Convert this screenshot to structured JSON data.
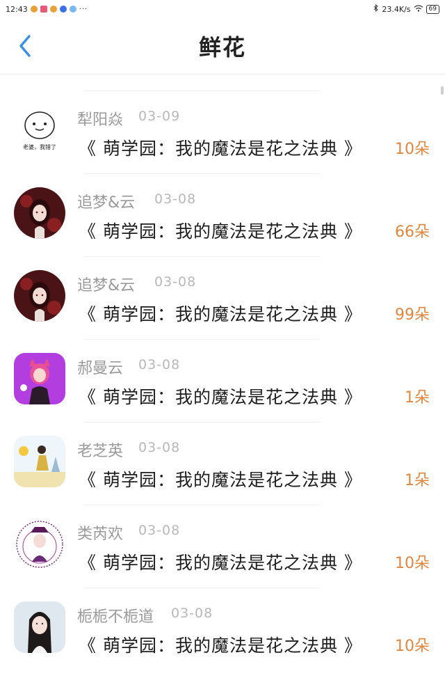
{
  "status_bar": {
    "time": "12:43",
    "network_speed": "23.4K/s",
    "battery": "69",
    "more": "···"
  },
  "header": {
    "title": "鲜花",
    "back_icon": "chevron-left-icon"
  },
  "colors": {
    "accent_blue": "#3a8ee6",
    "amount_orange": "#e0863e",
    "name_gray": "#9a9a9a",
    "date_gray": "#b8b8b8"
  },
  "records": [
    {
      "name": "犁阳焱",
      "date": "03-09",
      "book": "《 萌学园：我的魔法是花之法典 》",
      "amount": "10朵",
      "avatar_caption": "老婆，我错了"
    },
    {
      "name": "追梦&云",
      "date": "03-08",
      "book": "《 萌学园：我的魔法是花之法典 》",
      "amount": "66朵"
    },
    {
      "name": "追梦&云",
      "date": "03-08",
      "book": "《 萌学园：我的魔法是花之法典 》",
      "amount": "99朵"
    },
    {
      "name": "郝曼云",
      "date": "03-08",
      "book": "《 萌学园：我的魔法是花之法典 》",
      "amount": "1朵"
    },
    {
      "name": "老芝英",
      "date": "03-08",
      "book": "《 萌学园：我的魔法是花之法典 》",
      "amount": "1朵"
    },
    {
      "name": "类芮欢",
      "date": "03-08",
      "book": "《 萌学园：我的魔法是花之法典 》",
      "amount": "10朵"
    },
    {
      "name": "栀栀不栀道",
      "date": "03-08",
      "book": "《 萌学园：我的魔法是花之法典 》",
      "amount": "10朵"
    }
  ]
}
